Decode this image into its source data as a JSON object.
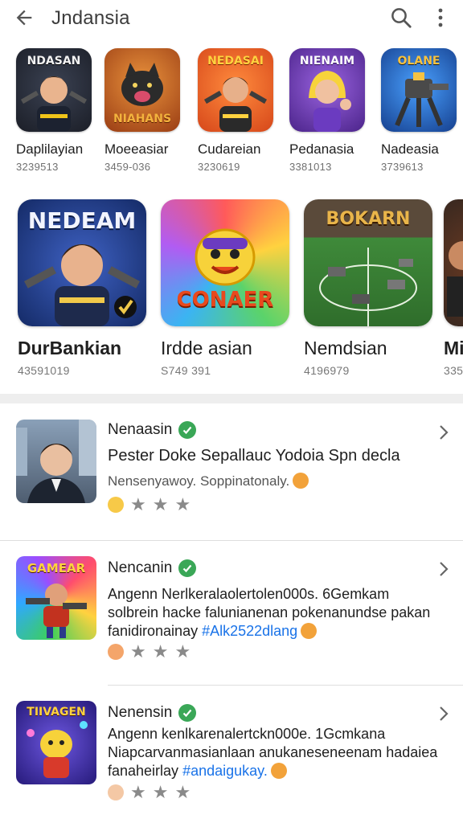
{
  "header": {
    "title": "Jndansia",
    "back_icon": "arrow-left-icon",
    "search_icon": "search-icon",
    "more_icon": "more-vert-icon"
  },
  "row1": [
    {
      "name": "Daplilayian",
      "meta": "3239513",
      "icon_text": "NDASAN",
      "bg": "#2b2f3a",
      "accent": "#f0c419"
    },
    {
      "name": "Moeeasiar",
      "meta": "3459-036",
      "icon_text": "NIAHANS",
      "bg": "#c8602a",
      "accent": "#f3b23d"
    },
    {
      "name": "Cudareian",
      "meta": "3230619",
      "icon_text": "NEDASAI",
      "bg": "#e55b1e",
      "accent": "#ffd23f"
    },
    {
      "name": "Pedanasia",
      "meta": "3381013",
      "icon_text": "NIENAIM",
      "bg": "#6c3fb3",
      "accent": "#f7d33b"
    },
    {
      "name": "Nadeasia",
      "meta": "3739613",
      "icon_text": "OLANE",
      "bg": "#1e5bb8",
      "accent": "#f5c242"
    }
  ],
  "row2": [
    {
      "name": "DurBankian",
      "meta": "43591019",
      "icon_text": "NEDEAM",
      "bg": "#1f3d8a",
      "accent": "#f1c94a"
    },
    {
      "name": "Irdde asian",
      "meta": "S749 391",
      "icon_text": "CONAER",
      "bg": "#f7d93a",
      "accent": "#e8491e"
    },
    {
      "name": "Nemdsian",
      "meta": "4196979",
      "icon_text": "BOKARN",
      "bg": "#3f7d33",
      "accent": "#e9b54a"
    },
    {
      "name": "Mi",
      "meta": "335",
      "icon_text": "",
      "bg": "#2a2a2a",
      "accent": "#c9692a"
    }
  ],
  "items": [
    {
      "title": "Nenaasin",
      "line1": "Pester Doke Sepallauc Yodoia Spn decla",
      "line2": "Nensenyawoy. Soppinatonaly.",
      "thumb_bg": "#5b6e86",
      "thumb_text": ""
    },
    {
      "title": "Nencanin",
      "line1": "Angenn Nerlkeralaolertolen000s. 6Gemkam",
      "line2": "solbrein hacke falunianenan pokenanundse pakan",
      "line3_text": "fanidironainay",
      "line3_tag": "#Alk2522dlang",
      "thumb_bg": "#6b2bb0",
      "thumb_text": "GAMEAR"
    },
    {
      "title": "Nenensin",
      "line1": "Angenn kenlkarenalertckn000e. 1Gcmkana",
      "line2": "Niapcarvanmasianlaan anukaneseneenam hadaiea",
      "line3_text": "fanaheirlay",
      "line3_tag": "#andaigukay.",
      "thumb_bg": "#2f4fb8",
      "thumb_text": "TIIVAGEN"
    }
  ],
  "colors": {
    "verified": "#3aa757",
    "hashtag": "#1a73e8",
    "divider_band": "#eeeeee"
  }
}
